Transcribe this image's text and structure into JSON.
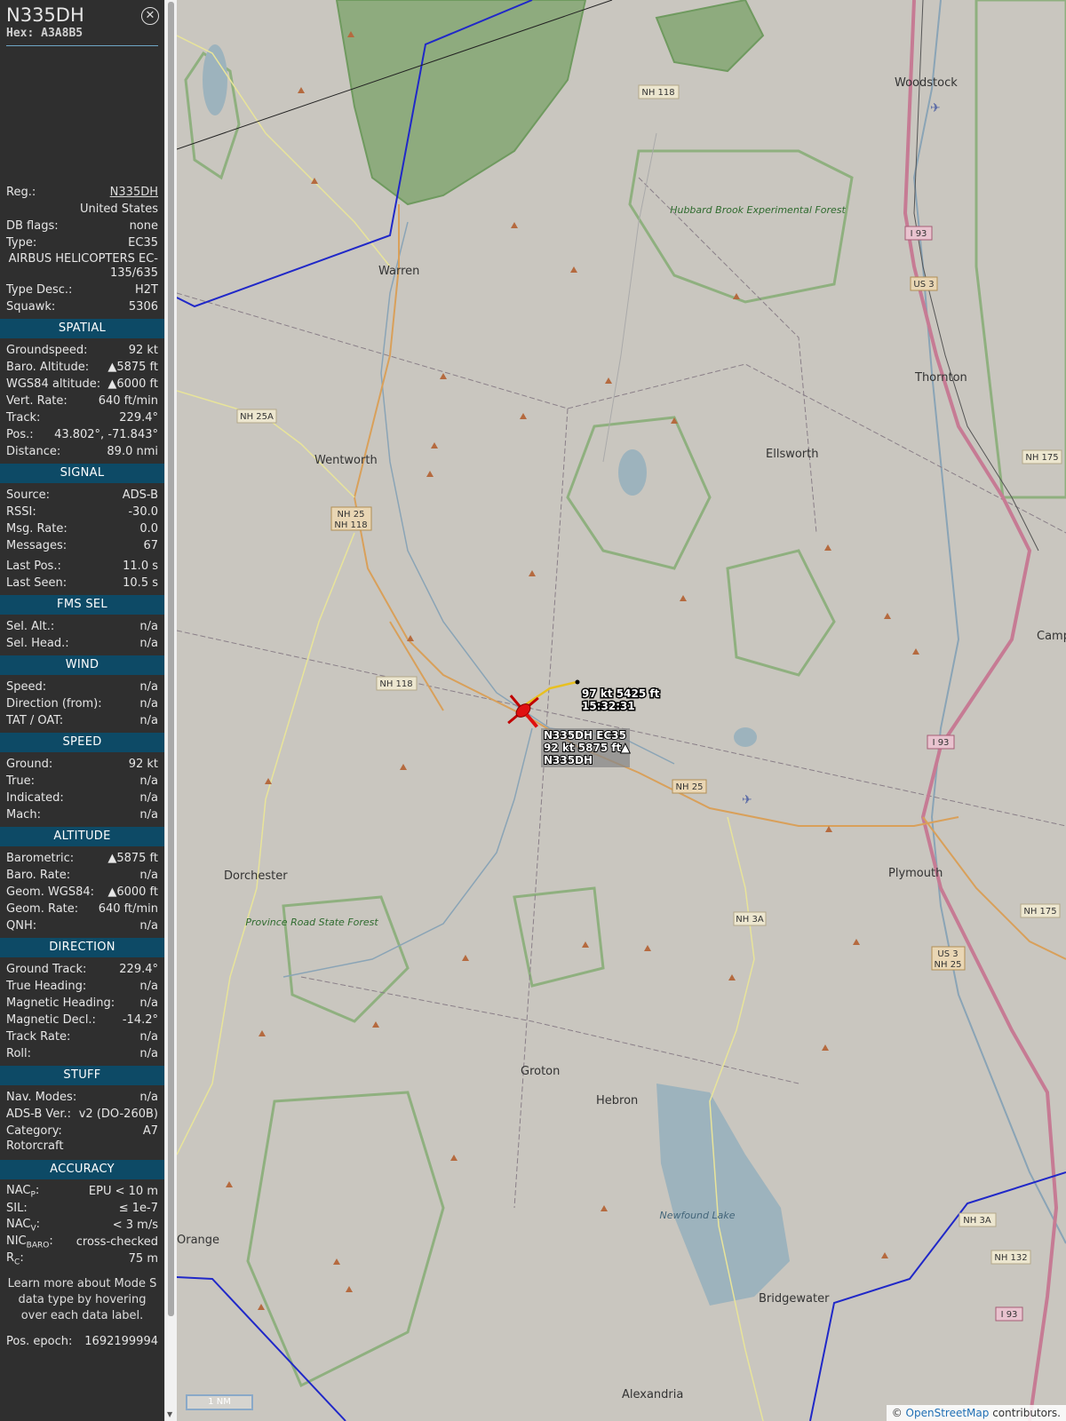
{
  "header": {
    "callsign": "N335DH",
    "hex_label": "Hex:",
    "hex": "A3A8B5",
    "close_icon": "close-icon"
  },
  "info": [
    {
      "label": "Reg.:",
      "value": "N335DH",
      "link": true
    },
    {
      "label": "",
      "value": "United States"
    },
    {
      "label": "DB flags:",
      "value": "none"
    },
    {
      "label": "Type:",
      "value": "EC35"
    },
    {
      "full": "AIRBUS HELICOPTERS EC-135/635"
    },
    {
      "label": "Type Desc.:",
      "value": "H2T"
    },
    {
      "label": "Squawk:",
      "value": "5306"
    }
  ],
  "sections": [
    {
      "title": "SPATIAL",
      "rows": [
        {
          "label": "Groundspeed:",
          "value": "92 kt"
        },
        {
          "label": "Baro. Altitude:",
          "value": "▲5875 ft"
        },
        {
          "label": "WGS84 altitude:",
          "value": "▲6000 ft"
        },
        {
          "label": "Vert. Rate:",
          "value": "640 ft/min"
        },
        {
          "label": "Track:",
          "value": "229.4°"
        },
        {
          "label": "Pos.:",
          "value": "43.802°, -71.843°"
        },
        {
          "label": "Distance:",
          "value": "89.0 nmi"
        }
      ]
    },
    {
      "title": "SIGNAL",
      "rows": [
        {
          "label": "Source:",
          "value": "ADS-B"
        },
        {
          "label": "RSSI:",
          "value": "-30.0"
        },
        {
          "label": "Msg. Rate:",
          "value": "0.0"
        },
        {
          "label": "Messages:",
          "value": "67"
        },
        {
          "gap": true
        },
        {
          "label": "Last Pos.:",
          "value": "11.0 s"
        },
        {
          "label": "Last Seen:",
          "value": "10.5 s"
        }
      ]
    },
    {
      "title": "FMS SEL",
      "rows": [
        {
          "label": "Sel. Alt.:",
          "value": "n/a"
        },
        {
          "label": "Sel. Head.:",
          "value": "n/a"
        }
      ]
    },
    {
      "title": "WIND",
      "rows": [
        {
          "label": "Speed:",
          "value": "n/a"
        },
        {
          "label": "Direction (from):",
          "value": "n/a"
        },
        {
          "label": "TAT / OAT:",
          "value": "n/a"
        }
      ]
    },
    {
      "title": "SPEED",
      "rows": [
        {
          "label": "Ground:",
          "value": "92 kt"
        },
        {
          "label": "True:",
          "value": "n/a"
        },
        {
          "label": "Indicated:",
          "value": "n/a"
        },
        {
          "label": "Mach:",
          "value": "n/a"
        }
      ]
    },
    {
      "title": "ALTITUDE",
      "rows": [
        {
          "label": "Barometric:",
          "value": "▲5875 ft"
        },
        {
          "label": "Baro. Rate:",
          "value": "n/a"
        },
        {
          "label": "Geom. WGS84:",
          "value": "▲6000 ft"
        },
        {
          "label": "Geom. Rate:",
          "value": "640 ft/min"
        },
        {
          "label": "QNH:",
          "value": "n/a"
        }
      ]
    },
    {
      "title": "DIRECTION",
      "rows": [
        {
          "label": "Ground Track:",
          "value": "229.4°"
        },
        {
          "label": "True Heading:",
          "value": "n/a"
        },
        {
          "label": "Magnetic Heading:",
          "value": "n/a"
        },
        {
          "label": "Magnetic Decl.:",
          "value": "-14.2°"
        },
        {
          "label": "Track Rate:",
          "value": "n/a"
        },
        {
          "label": "Roll:",
          "value": "n/a"
        }
      ]
    },
    {
      "title": "STUFF",
      "rows": [
        {
          "label": "Nav. Modes:",
          "value": "n/a"
        },
        {
          "label": "ADS-B Ver.:",
          "value": "v2 (DO-260B)"
        },
        {
          "label": "Category:",
          "value": "A7"
        },
        {
          "leftonly": "Rotorcraft"
        }
      ]
    },
    {
      "title": "ACCURACY",
      "rows": [
        {
          "label": "NACP:",
          "value": "EPU < 10 m"
        },
        {
          "label": "SIL:",
          "value": "≤ 1e-7"
        },
        {
          "label": "NACV:",
          "value": "< 3 m/s"
        },
        {
          "label": "NICBARO:",
          "value": "cross-checked"
        },
        {
          "label": "RC:",
          "value": "75 m"
        }
      ]
    }
  ],
  "note": "Learn more about Mode S data type by hovering over each data label.",
  "epoch": {
    "label": "Pos. epoch:",
    "value": "1692199994"
  },
  "map": {
    "towns": [
      "Woodstock",
      "Warren",
      "Thornton",
      "Ellsworth",
      "Wentworth",
      "Campton",
      "Dorchester",
      "Plymouth",
      "Groton",
      "Hebron",
      "Orange",
      "Bridgewater",
      "Alexandria"
    ],
    "forests": [
      "Hubbard Brook Experimental Forest",
      "Province Road State Forest"
    ],
    "lake": "Newfound Lake",
    "roads": [
      "NH 118",
      "NH 25A",
      "NH 25",
      "NH 3A",
      "I 93",
      "US 3",
      "NH 175",
      "NH 132"
    ],
    "aircraft_label": {
      "line1": "N335DH EC35",
      "line2": "92 kt  5875 ft▲",
      "line3": "N335DH"
    },
    "track_label": {
      "line1": "97 kt  5425 ft",
      "line2": "15:32:31"
    },
    "scale": "1 NM",
    "attribution": {
      "prefix": "© ",
      "link": "OpenStreetMap",
      "suffix": " contributors."
    }
  }
}
